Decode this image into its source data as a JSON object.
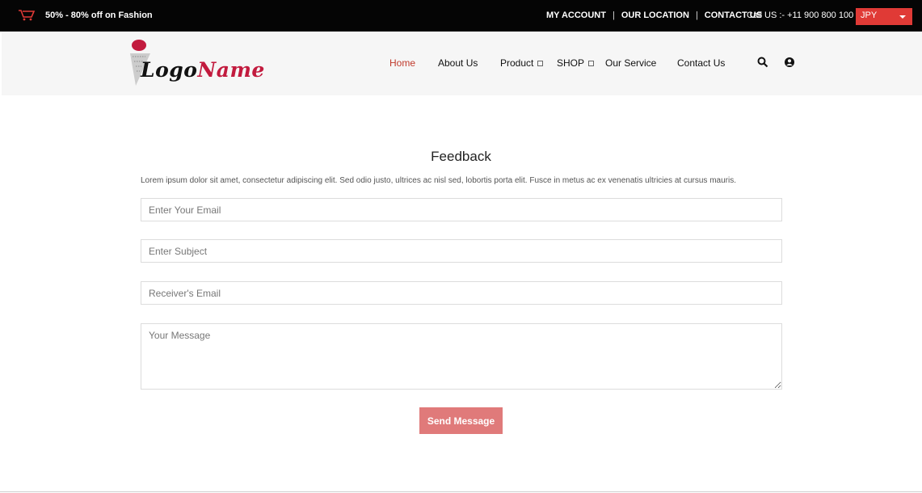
{
  "topbar": {
    "promo": "50% - 80% off on Fashion",
    "links": [
      "MY ACCOUNT",
      "OUR LOCATION",
      "CONTACT US"
    ],
    "separator": "|",
    "call": "Call US :- +11 900 800 100",
    "currency": "JPY"
  },
  "logo": {
    "part1": "Logo",
    "part2": "Name"
  },
  "nav": {
    "home": "Home",
    "about": "About Us",
    "product": "Product",
    "shop": "SHOP",
    "service": "Our Service",
    "contact": "Contact Us"
  },
  "feedback": {
    "title": "Feedback",
    "lead": "Lorem ipsum dolor sit amet, consectetur adipiscing elit. Sed odio justo, ultrices ac nisl sed, lobortis porta elit. Fusce in metus ac ex venenatis ultricies at cursus mauris.",
    "email_placeholder": "Enter Your Email",
    "subject_placeholder": "Enter Subject",
    "receiver_placeholder": "Receiver's Email",
    "message_placeholder": "Your Message",
    "send_label": "Send Message"
  },
  "icons": {
    "cart": "cart-icon",
    "search": "search-icon",
    "user": "user-icon",
    "caret": "caret-down-icon"
  },
  "colors": {
    "accent": "#e03a36",
    "nav_active": "#c0392b",
    "button": "#e07a7a",
    "logo_red": "#c21b3e"
  }
}
